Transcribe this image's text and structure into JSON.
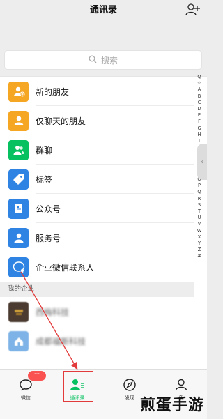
{
  "header": {
    "title": "通讯录",
    "add_icon": "add-friend-icon"
  },
  "search": {
    "placeholder": "搜索",
    "icon": "search-icon"
  },
  "menu_items": [
    {
      "label": "新的朋友",
      "color": "#f5a623",
      "icon": "add-person-icon"
    },
    {
      "label": "仅聊天的朋友",
      "color": "#f5a623",
      "icon": "person-icon"
    },
    {
      "label": "群聊",
      "color": "#07c160",
      "icon": "group-icon"
    },
    {
      "label": "标签",
      "color": "#2f83e3",
      "icon": "tag-icon"
    },
    {
      "label": "公众号",
      "color": "#2f83e3",
      "icon": "official-account-icon"
    },
    {
      "label": "服务号",
      "color": "#2f83e3",
      "icon": "service-account-icon"
    },
    {
      "label": "企业微信联系人",
      "color": "#2f83e3",
      "icon": "enterprise-contact-icon"
    }
  ],
  "enterprise_section": {
    "title": "我的企业",
    "items": [
      {
        "label": "西梅科技"
      },
      {
        "label": "成都福斯科技"
      }
    ]
  },
  "alphabet": [
    "Q",
    "☆",
    "A",
    "B",
    "C",
    "D",
    "E",
    "F",
    "G",
    "H",
    "I",
    "J",
    "K",
    "L",
    "M",
    "N",
    "O",
    "P",
    "Q",
    "R",
    "S",
    "T",
    "U",
    "V",
    "W",
    "X",
    "Y",
    "Z",
    "#"
  ],
  "tabs": [
    {
      "label": "微信",
      "icon": "chat-icon",
      "badge": "···"
    },
    {
      "label": "通讯录",
      "icon": "contacts-icon",
      "active": true
    },
    {
      "label": "发现",
      "icon": "compass-icon"
    },
    {
      "label": "我",
      "icon": "profile-icon"
    }
  ],
  "watermark": "煎蛋手游",
  "colors": {
    "accent": "#07c160",
    "annotation": "#e33b3b"
  }
}
